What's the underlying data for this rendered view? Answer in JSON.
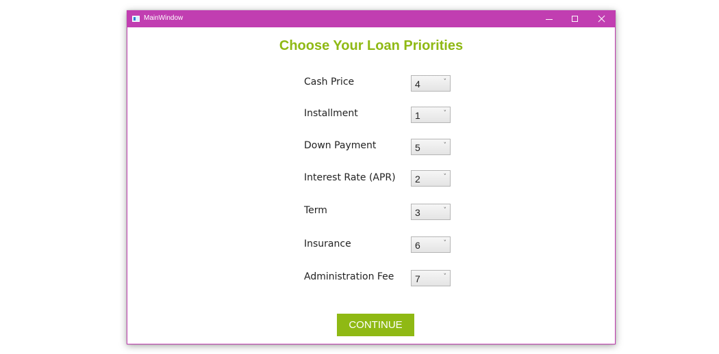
{
  "window": {
    "title": "MainWindow"
  },
  "heading": "Choose Your Loan Priorities",
  "priorities": [
    {
      "label": "Cash Price",
      "value": "4"
    },
    {
      "label": "Installment",
      "value": "1"
    },
    {
      "label": "Down Payment",
      "value": "5"
    },
    {
      "label": "Interest Rate (APR)",
      "value": "2"
    },
    {
      "label": "Term",
      "value": "3"
    },
    {
      "label": "Insurance",
      "value": "6"
    },
    {
      "label": "Administration Fee",
      "value": "7"
    }
  ],
  "combo_arrow_glyph": "˅",
  "continue_label": "CONTINUE",
  "colors": {
    "titlebar": "#c13eb1",
    "accent": "#8fb914"
  }
}
